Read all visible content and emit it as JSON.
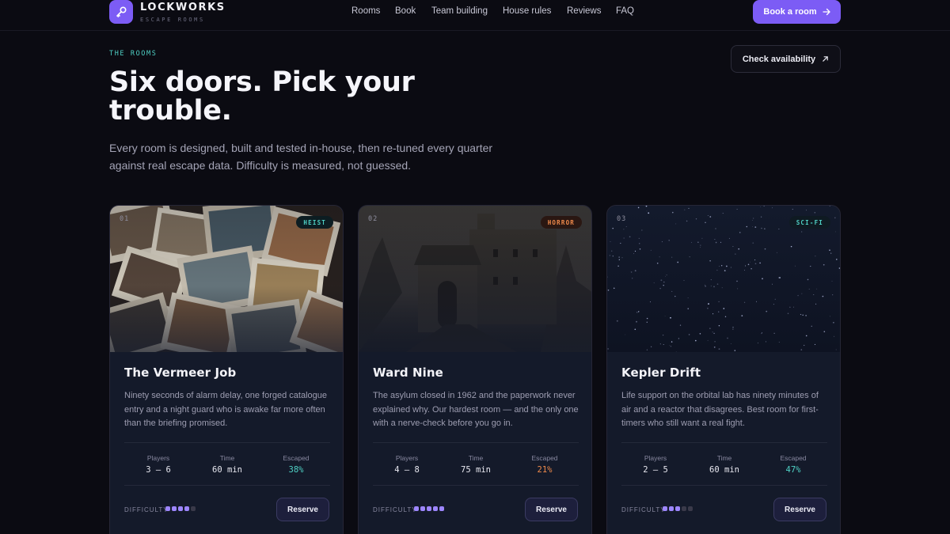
{
  "brand": {
    "name": "LOCKWORKS",
    "tagline": "ESCAPE ROOMS",
    "icon": "key-icon"
  },
  "nav": {
    "links": [
      "Rooms",
      "Book",
      "Team building",
      "House rules",
      "Reviews",
      "FAQ"
    ],
    "cta_label": "Book a room",
    "cta_icon": "arrow-right-icon"
  },
  "hero": {
    "eyebrow": "THE ROOMS",
    "title": "Six doors. Pick your trouble.",
    "description": "Every room is designed, built and tested in-house, then re-tuned every quarter against real escape data. Difficulty is measured, not guessed.",
    "availability_label": "Check availability",
    "availability_icon": "arrow-up-right-icon"
  },
  "colors": {
    "accent": "#7c5cf5",
    "teal": "#4fd1c5",
    "orange": "#f08a4b",
    "background": "#0b0b12"
  },
  "stat_labels": {
    "players": "Players",
    "time": "Time",
    "escaped": "Escaped"
  },
  "difficulty_label": "DIFFICULTY",
  "rooms": [
    {
      "number": "01",
      "genre": "HEIST",
      "title": "The Vermeer Job",
      "description": "Ninety seconds of alarm delay, one forged catalogue entry and a night guard who is awake far more often than the briefing promised.",
      "players": "3 – 6",
      "time": "60 min",
      "escaped": "38%",
      "difficulty": 4,
      "difficulty_max": 5,
      "reserve_label": "Reserve"
    },
    {
      "number": "02",
      "genre": "HORROR",
      "title": "Ward Nine",
      "description": "The asylum closed in 1962 and the paperwork never explained why. Our hardest room — and the only one with a nerve-check before you go in.",
      "players": "4 – 8",
      "time": "75 min",
      "escaped": "21%",
      "difficulty": 5,
      "difficulty_max": 5,
      "reserve_label": "Reserve"
    },
    {
      "number": "03",
      "genre": "SCI-FI",
      "title": "Kepler Drift",
      "description": "Life support on the orbital lab has ninety minutes of air and a reactor that disagrees. Best room for first-timers who still want a real fight.",
      "players": "2 – 5",
      "time": "60 min",
      "escaped": "47%",
      "difficulty": 3,
      "difficulty_max": 5,
      "reserve_label": "Reserve"
    }
  ]
}
